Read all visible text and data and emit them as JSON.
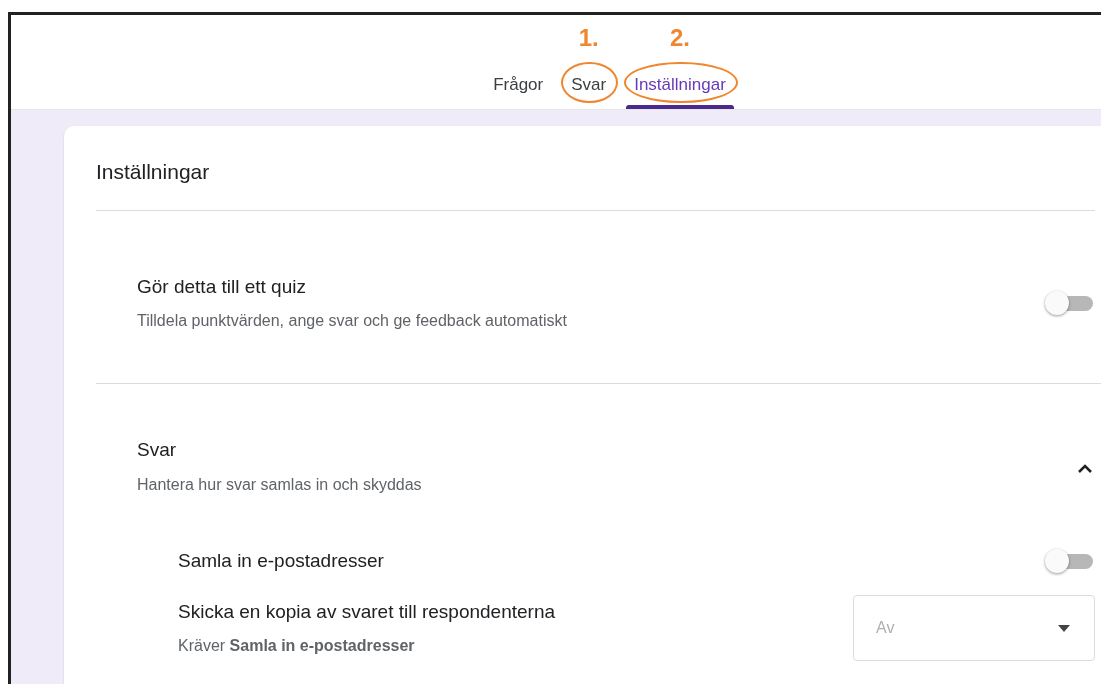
{
  "tabs": [
    {
      "label": "Frågor",
      "selected": false
    },
    {
      "label": "Svar",
      "selected": false,
      "annotation": "1."
    },
    {
      "label": "Inställningar",
      "selected": true,
      "annotation": "2."
    }
  ],
  "panel": {
    "title": "Inställningar",
    "sections": [
      {
        "kind": "toggle",
        "title": "Gör detta till ett quiz",
        "description": "Tilldela punktvärden, ange svar och ge feedback automatiskt",
        "on": false
      },
      {
        "kind": "expandable",
        "title": "Svar",
        "description": "Hantera hur svar samlas in och skyddas",
        "expanded": true,
        "children": [
          {
            "kind": "toggle",
            "title": "Samla in e-postadresser",
            "on": false
          },
          {
            "kind": "dropdown",
            "title": "Skicka en kopia av svaret till respondenterna",
            "description": "Kräver **Samla in e-postadresser**",
            "value": "Av",
            "disabled": true
          }
        ]
      }
    ]
  }
}
